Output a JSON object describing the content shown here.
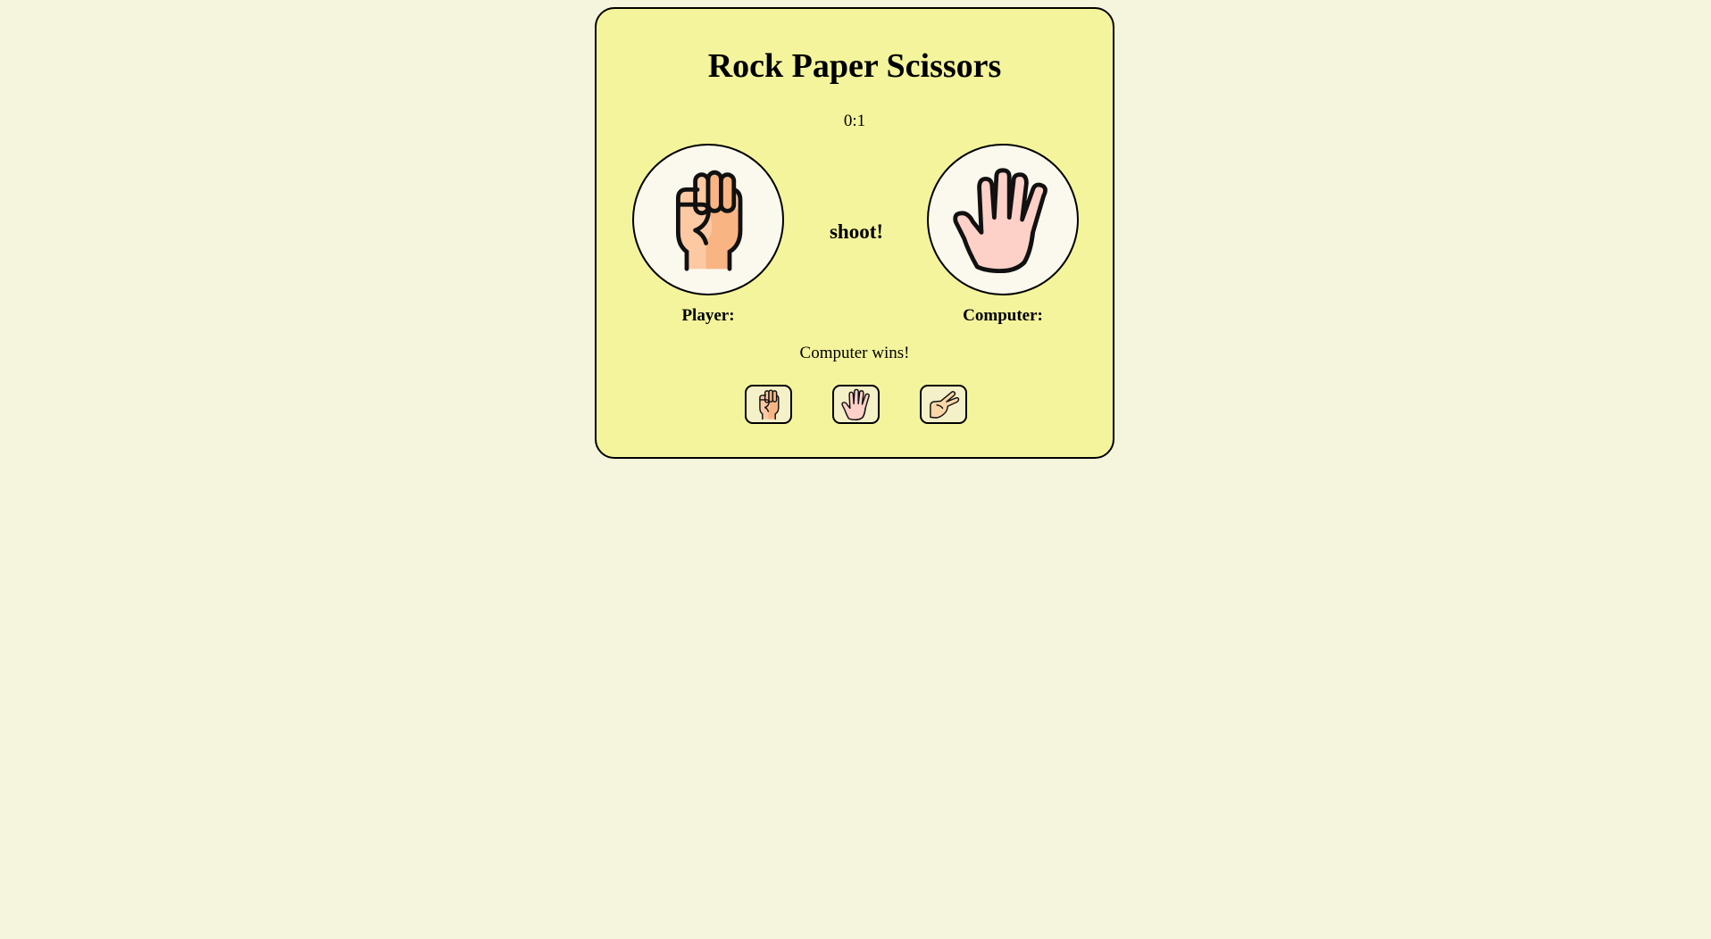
{
  "app": {
    "title": "Rock Paper Scissors",
    "score": "0:1",
    "center_text": "shoot!",
    "result": "Computer wins!"
  },
  "player": {
    "label": "Player:",
    "choice_icon": "rock-fist-icon"
  },
  "computer": {
    "label": "Computer:",
    "choice_icon": "paper-hand-icon"
  },
  "choices": [
    {
      "name": "rock",
      "icon": "rock-fist-icon"
    },
    {
      "name": "paper",
      "icon": "paper-hand-icon"
    },
    {
      "name": "scissors",
      "icon": "scissors-hand-icon"
    }
  ],
  "colors": {
    "page_background": "#f5f4dc",
    "card_background": "#f4f49c",
    "circle_background": "#fbf8ee",
    "fist_skin": "#fcc9a3",
    "fist_shade": "#f9b483",
    "paper_skin": "#fdd0c8",
    "scissors_skin": "#fbd7a8"
  }
}
